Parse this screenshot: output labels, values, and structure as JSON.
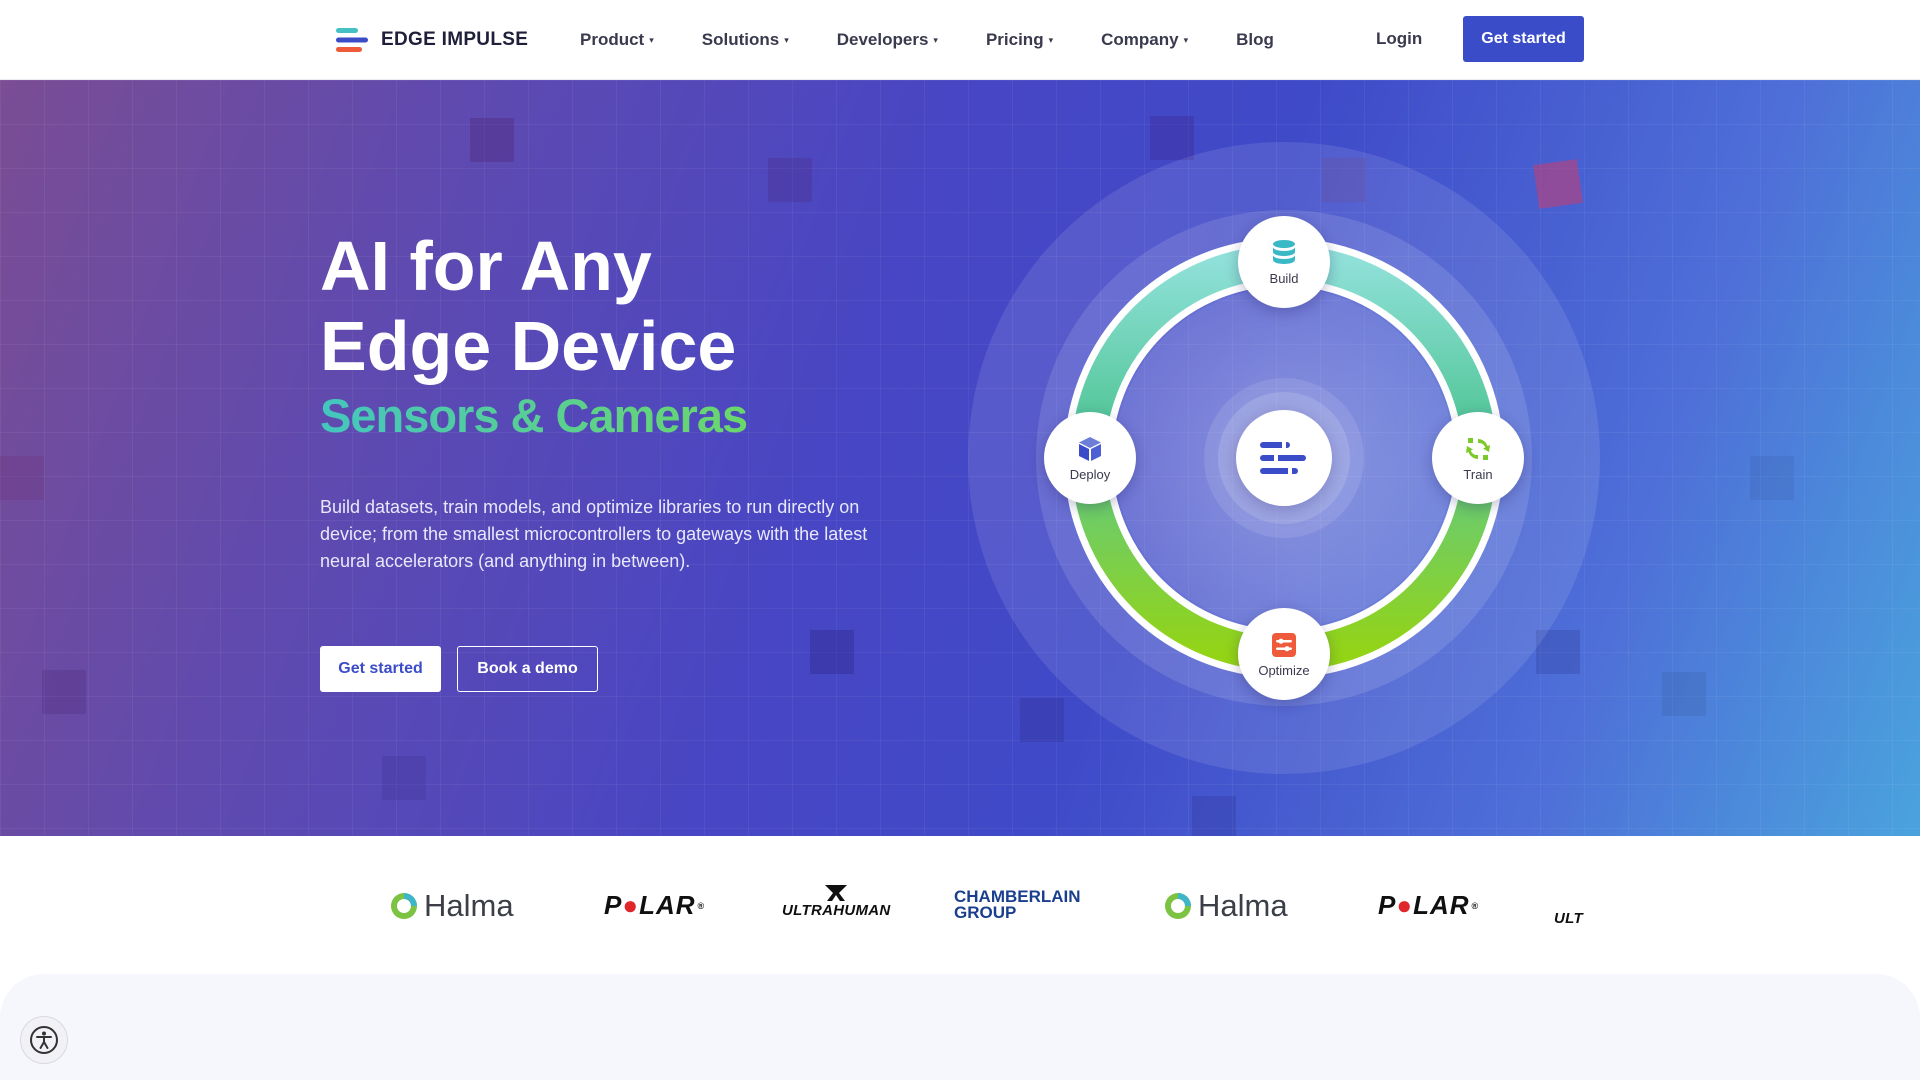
{
  "brand": {
    "name": "EDGE IMPULSE",
    "logo_icon": "edge-impulse-logo-icon"
  },
  "nav": {
    "items": [
      {
        "label": "Product",
        "has_dropdown": true
      },
      {
        "label": "Solutions",
        "has_dropdown": true
      },
      {
        "label": "Developers",
        "has_dropdown": true
      },
      {
        "label": "Pricing",
        "has_dropdown": true
      },
      {
        "label": "Company",
        "has_dropdown": true
      },
      {
        "label": "Blog",
        "has_dropdown": false
      }
    ],
    "caret": "▾",
    "login_label": "Login",
    "cta_label": "Get started"
  },
  "hero": {
    "title_line1": "AI for Any",
    "title_line2": "Edge Device",
    "subtitle": "Sensors & Cameras",
    "description": "Build datasets, train models, and optimize libraries to run directly on device; from the smallest microcontrollers to gateways with the latest neural accelerators (and anything in between).",
    "primary_button": "Get started",
    "secondary_button": "Book a demo"
  },
  "cycle": {
    "stages": [
      {
        "key": "build",
        "label": "Build",
        "icon": "database-icon"
      },
      {
        "key": "train",
        "label": "Train",
        "icon": "refresh-icon"
      },
      {
        "key": "optimize",
        "label": "Optimize",
        "icon": "sliders-icon"
      },
      {
        "key": "deploy",
        "label": "Deploy",
        "icon": "box-icon"
      }
    ],
    "center_icon": "edge-impulse-logo-icon"
  },
  "logos": [
    {
      "name": "Halma",
      "text": "Halma"
    },
    {
      "name": "Polar",
      "text": "P●LAR",
      "mark": "®"
    },
    {
      "name": "Ultrahuman",
      "text": "ULTRAHUMAN"
    },
    {
      "name": "Chamberlain Group",
      "line1": "CHAMBERLAIN",
      "line2": "GROUP"
    },
    {
      "name": "Halma",
      "text": "Halma"
    },
    {
      "name": "Polar",
      "text": "P●LAR",
      "mark": "®"
    },
    {
      "name": "Ultrahuman",
      "text": "ULT"
    }
  ],
  "colors": {
    "brand_blue": "#3b4cc9",
    "teal": "#44c6bf",
    "green": "#6bd76a",
    "ring_start": "#5fd0c6",
    "ring_end": "#8fd41a",
    "polar_red": "#e0262b",
    "halma_green": "#7cc243",
    "chamberlain_blue": "#1b3f8f"
  },
  "accessibility": {
    "icon": "accessibility-icon"
  }
}
